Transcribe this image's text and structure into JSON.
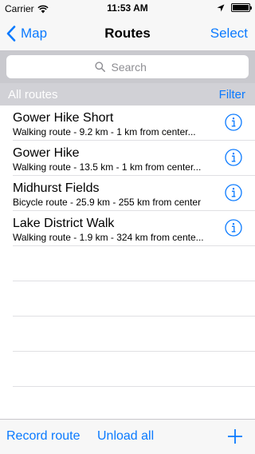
{
  "status": {
    "carrier": "Carrier",
    "time": "11:53 AM",
    "battery_level": 1.0
  },
  "nav": {
    "back_label": "Map",
    "title": "Routes",
    "select_label": "Select"
  },
  "search": {
    "placeholder": "Search",
    "value": ""
  },
  "section": {
    "title": "All routes",
    "filter_label": "Filter"
  },
  "routes": [
    {
      "title": "Gower Hike Short",
      "subtitle": "Walking route - 9.2 km - 1 km from center..."
    },
    {
      "title": "Gower Hike",
      "subtitle": "Walking route - 13.5 km - 1 km from center..."
    },
    {
      "title": "Midhurst Fields",
      "subtitle": "Bicycle route - 25.9 km - 255 km from center"
    },
    {
      "title": "Lake District Walk",
      "subtitle": "Walking route - 1.9 km - 324 km from cente..."
    }
  ],
  "toolbar": {
    "record_label": "Record route",
    "unload_label": "Unload all"
  },
  "colors": {
    "accent": "#0a7aff",
    "section_header_bg": "#d1d1d6",
    "search_bar_bg": "#c9c9ce"
  },
  "icons": {
    "back": "chevron-left-icon",
    "wifi": "wifi-icon",
    "location": "location-arrow-icon",
    "battery": "battery-icon",
    "search": "search-icon",
    "info": "info-icon",
    "add": "plus-icon"
  }
}
